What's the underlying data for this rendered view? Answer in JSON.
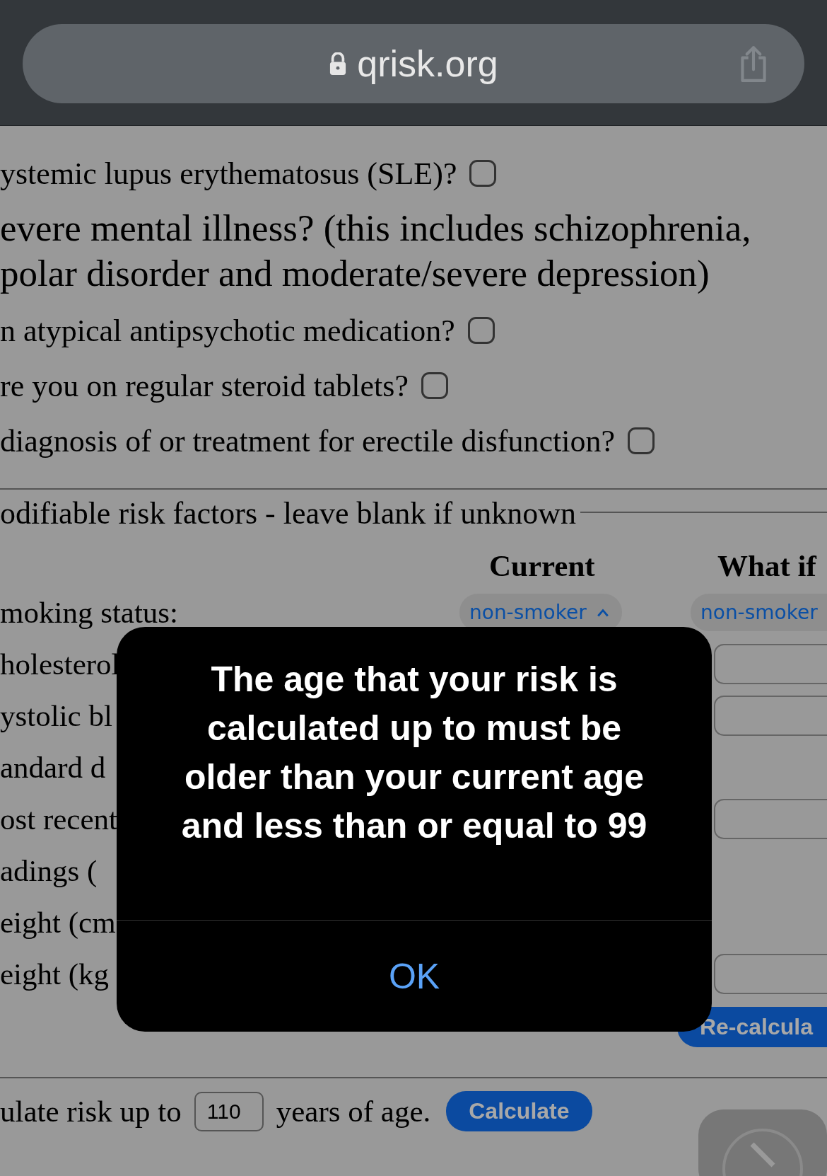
{
  "browser": {
    "url": "qrisk.org"
  },
  "questions": [
    {
      "kind": "checkbox",
      "label": "ystemic lupus erythematosus (SLE)?",
      "checked": false
    },
    {
      "kind": "heading",
      "label": "evere mental illness? (this includes schizophrenia,\npolar disorder and moderate/severe depression)"
    },
    {
      "kind": "checkbox",
      "label": "n atypical antipsychotic medication?",
      "checked": false
    },
    {
      "kind": "checkbox",
      "label": "re you on regular steroid tablets?",
      "checked": false
    },
    {
      "kind": "checkbox",
      "label": "diagnosis of or treatment for erectile disfunction?",
      "checked": false
    }
  ],
  "risk_factors": {
    "legend": "odifiable risk factors - leave blank if unknown",
    "columns": [
      "Current",
      "What if"
    ],
    "rows": [
      {
        "kind": "select",
        "label": "moking status:",
        "current": "non-smoker",
        "what_if": "non-smoker"
      },
      {
        "kind": "input",
        "label": "holesterol"
      },
      {
        "kind": "input",
        "label": "ystolic bl"
      },
      {
        "kind": "text",
        "label": "andard d"
      },
      {
        "kind": "input",
        "label": "ost recent"
      },
      {
        "kind": "text",
        "label": "adings ("
      },
      {
        "kind": "text",
        "label": "eight (cm"
      },
      {
        "kind": "input",
        "label": "eight (kg"
      }
    ],
    "recalculate": "Re-calcula"
  },
  "calculate": {
    "prefix": "ulate risk up to",
    "age": "110",
    "suffix": "years of age.",
    "button": "Calculate"
  },
  "alert": {
    "message": "The age that your risk is calculated up to must be older than your current age and less than or equal to 99",
    "button": "OK"
  }
}
